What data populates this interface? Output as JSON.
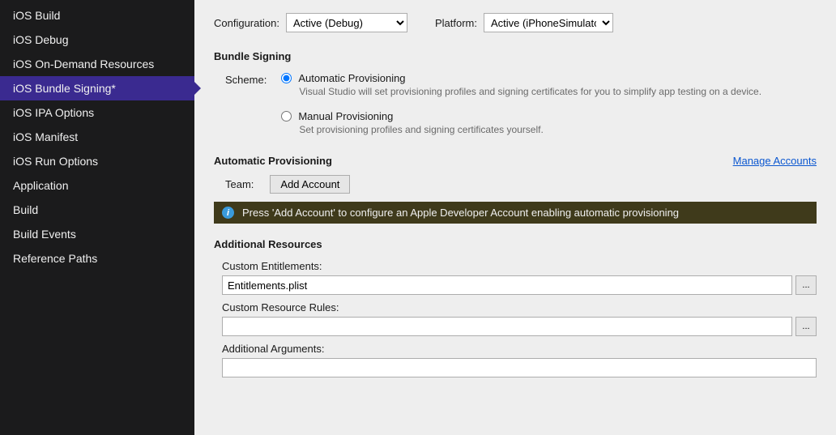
{
  "sidebar": {
    "items": [
      {
        "label": "iOS Build"
      },
      {
        "label": "iOS Debug"
      },
      {
        "label": "iOS On-Demand Resources"
      },
      {
        "label": "iOS Bundle Signing*"
      },
      {
        "label": "iOS IPA Options"
      },
      {
        "label": "iOS Manifest"
      },
      {
        "label": "iOS Run Options"
      },
      {
        "label": "Application"
      },
      {
        "label": "Build"
      },
      {
        "label": "Build Events"
      },
      {
        "label": "Reference Paths"
      }
    ]
  },
  "top": {
    "config_label": "Configuration:",
    "config_value": "Active (Debug)",
    "platform_label": "Platform:",
    "platform_value": "Active (iPhoneSimulator)"
  },
  "bundle": {
    "title": "Bundle Signing",
    "scheme_label": "Scheme:",
    "auto_title": "Automatic Provisioning",
    "auto_desc": "Visual Studio will set provisioning profiles and signing certificates for you to simplify app testing on a device.",
    "manual_title": "Manual Provisioning",
    "manual_desc": "Set provisioning profiles and signing certificates yourself."
  },
  "autoprov": {
    "title": "Automatic Provisioning",
    "manage_link": "Manage Accounts",
    "team_label": "Team:",
    "add_account_btn": "Add Account",
    "info_text": "Press 'Add Account' to configure an Apple Developer Account enabling automatic provisioning",
    "info_glyph": "i"
  },
  "additional": {
    "title": "Additional Resources",
    "entitlements_label": "Custom Entitlements:",
    "entitlements_value": "Entitlements.plist",
    "resource_rules_label": "Custom Resource Rules:",
    "resource_rules_value": "",
    "args_label": "Additional Arguments:",
    "args_value": "",
    "browse_glyph": "..."
  }
}
